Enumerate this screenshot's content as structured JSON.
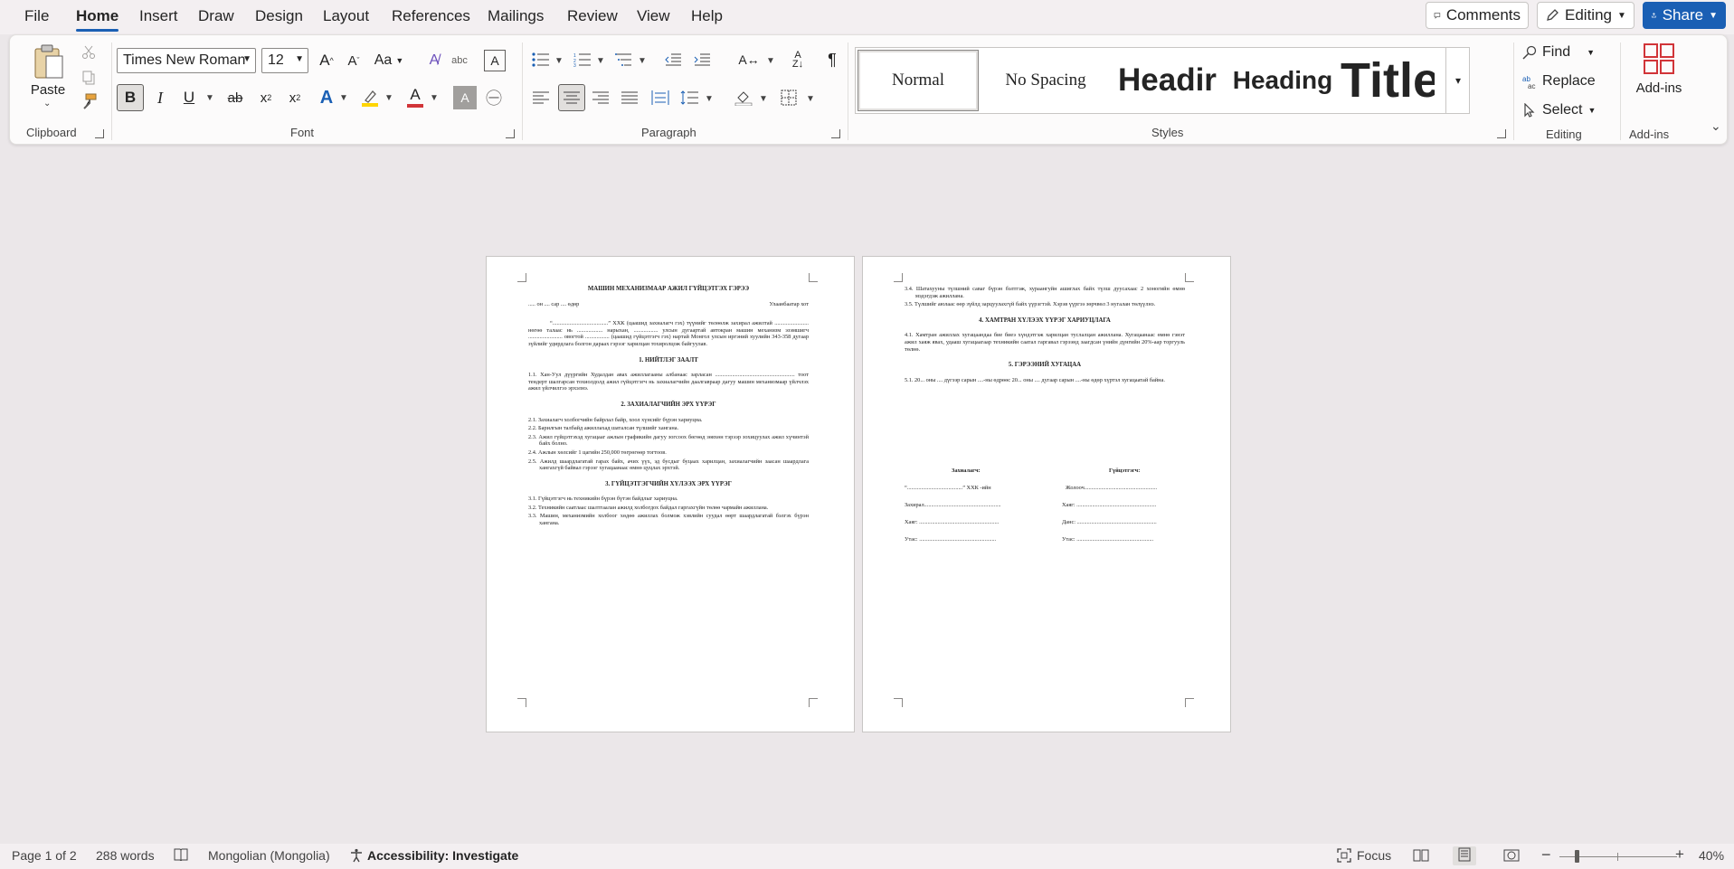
{
  "menu": {
    "items": [
      "File",
      "Home",
      "Insert",
      "Draw",
      "Design",
      "Layout",
      "References",
      "Mailings",
      "Review",
      "View",
      "Help"
    ],
    "active": "Home",
    "comments_label": "Comments",
    "editing_label": "Editing",
    "share_label": "Share"
  },
  "ribbon": {
    "clipboard": {
      "paste_label": "Paste",
      "group_label": "Clipboard"
    },
    "font": {
      "name": "Times New Roman",
      "size": "12",
      "group_label": "Font",
      "aa_label": "Aa"
    },
    "paragraph": {
      "group_label": "Paragraph"
    },
    "styles": {
      "group_label": "Styles",
      "items": [
        {
          "label": "Normal"
        },
        {
          "label": "No Spacing"
        },
        {
          "label": "Headir"
        },
        {
          "label": "Heading"
        },
        {
          "label": "Title"
        }
      ]
    },
    "editing": {
      "find_label": "Find",
      "replace_label": "Replace",
      "select_label": "Select",
      "group_label": "Editing"
    },
    "addins": {
      "label": "Add-ins",
      "group_label": "Add-ins"
    }
  },
  "document": {
    "page1": {
      "title": "МАШИН МЕХАНИЗМААР АЖИЛ ГҮЙЦЭТГЭХ ГЭРЭЭ",
      "date_line": "..... он .... сар .... өдөр",
      "city": "Улаанбаатар хот",
      "intro": "“.......................................” ХХК (цаашид захиалагч гэх) түүнийг төлөөлж захирал ажилтай ........................ нөгөө талаас нь .................. нарыхан, ................. улсын дугаартай автокран машин механизм эзэмшигч ........................ овогтой ................. (цаашид гүйцэтгэгч гэх) нартай Монгол улсын иргэний хуулийн 343-358 дугаар зүйлийг удирдлага болгон дараах гэрээг харилцан тохиролцож байгуулав.",
      "s1_title": "1. НИЙТЛЭГ ЗААЛТ",
      "s1_p1": "1.1. Хан-Уул дүүргийн Худалдан авах ажиллагааны албанаас зарласан ........................................................ тоот тендерт шалгарсан тохиолдолд ажил гүйцэтгэгч нь захиалагчийн даалгавраар дагуу машин механизмаар үйлчлэх ажил үйлчилгээ эрхэлнэ.",
      "s2_title": "2. ЗАХИАЛАГЧИЙН ЭРХ ҮҮРЭГ",
      "s2_items": [
        "2.1. Захиалагч холбогчийн байрлал байр, хоол хүнсийг бүрэн хариуцна.",
        "2.2. Барилгын талбайд ажиллахад шаталсан түлшийг хангана.",
        "2.3. Ажил гүйцэтгэхэд хугацааг ажлын графикийн дагуу зогсоох бөгөөд зөвхөн тэрээр зохицуулах ажил хүчинтэй байх болно.",
        "2.4. Ажлын хөлсийг 1 цагийн 250,000 төгрөгөөр тогтоов.",
        "2.5. Ажилд шаардлагатай гарах байх, ачих үүх, эд бусдыг буцаах харилцан, захиалагчийн заасан шаардлага хангахгүй байвал гэрээг хугацаанаас өмнө цуцлах эрхтэй."
      ],
      "s3_title": "3. ГҮЙЦЭТГЭГЧИЙН ХҮЛЭЭХ ЭРХ ҮҮРЭГ",
      "s3_items": [
        "3.1. Гүйцэтгэгч нь техникийн бүрэн бүтэн байдлыг хариуцна.",
        "3.2. Техникийн саатлаас шалтгаалан ажилд холбогдох байдал гаргахгүйн төлөө чармайн ажиллана.",
        "3.3. Машин, механизмийн холбоог хөдөө ажиллах болмож хэвлийн суудал өөрт шаардлагатай бэлгэх бүрэн хангана."
      ]
    },
    "page2": {
      "items_top": [
        "3.4. Шатахууны түлшний саваг бүрэн бэлтгэж, хураангуйн ашиглах байх түлш дуусахаас 2 хоногийн өмнө мэдэгдэж ажиллана.",
        "3.5. Түлшийг аюлаас өөр зүйлд зарцуулахгүй байх үүрэгтэй. Хэрэв үүргээ зөрчвөл 3 нугалан төлүүлнэ."
      ],
      "s4_title": "4. ХАМТРАН ХҮЛЭЭХ ҮҮРЭГ ХАРИУЦЛАГА",
      "s4_p1": "4.1. Хамтран ажиллах хугацаандаа бие биеэ хүндэтгэж харилцан туслалцан ажиллана. Хугацаанаас өмнө гэнэт ажил хаяж явах, удааш хугацаагаар техникийн саатал гаргавал гэрээнд заагдсан үнийн дүнгийн 20%-аар торгууль төлнө.",
      "s5_title": "5. ГЭРЭЭНИЙ ХУГАЦАА",
      "s5_p1": "5.1. 20... оны .... дүгээр сарын ....-ны өдрөөс 20... оны .... дугаар сарын ....-ны өдөр хүртэл хугацаатай байна.",
      "sig_left_title": "Захиалагч:",
      "sig_right_title": "Гүйцэтгэгч:",
      "sig_left_lines": [
        "“.......................................” ХХК -ийн",
        "Захирал......................................................",
        "Хаяг: ........................................................",
        "Утас: ......................................................"
      ],
      "sig_right_lines": [
        "Жолооч...................................................",
        "Хаяг: ........................................................",
        "Данс: ........................................................",
        "Утас: ......................................................"
      ]
    }
  },
  "status": {
    "page": "Page 1 of 2",
    "words": "288 words",
    "language": "Mongolian (Mongolia)",
    "accessibility": "Accessibility: Investigate",
    "focus": "Focus",
    "zoom_pct": "40%"
  },
  "colors": {
    "accent": "#1a5fb4",
    "highlight": "#ffd500",
    "font_red": "#d13438"
  }
}
